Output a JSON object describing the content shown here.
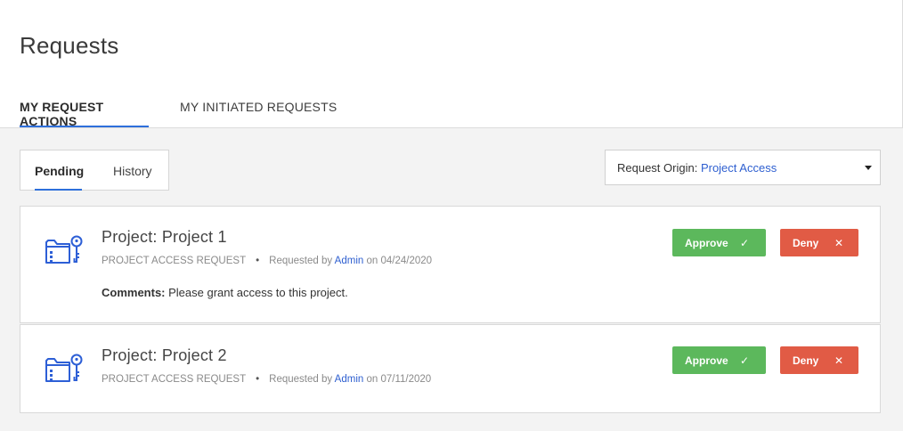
{
  "page": {
    "title": "Requests"
  },
  "main_tabs": [
    {
      "label": "MY REQUEST ACTIONS",
      "active": true
    },
    {
      "label": "MY INITIATED REQUESTS",
      "active": false
    }
  ],
  "sub_tabs": [
    {
      "label": "Pending",
      "active": true
    },
    {
      "label": "History",
      "active": false
    }
  ],
  "filter": {
    "label": "Request Origin: ",
    "value": "Project Access"
  },
  "requests": [
    {
      "title": "Project: Project 1",
      "type": "PROJECT ACCESS REQUEST",
      "requested_by_prefix": "Requested by ",
      "requester": "Admin",
      "date_prefix": " on ",
      "date": "04/24/2020",
      "comment_label": "Comments:",
      "comment": " Please grant access to this project.",
      "approve_label": "Approve",
      "deny_label": "Deny"
    },
    {
      "title": "Project: Project 2",
      "type": "PROJECT ACCESS REQUEST",
      "requested_by_prefix": "Requested by ",
      "requester": "Admin",
      "date_prefix": " on ",
      "date": "07/11/2020",
      "approve_label": "Approve",
      "deny_label": "Deny"
    }
  ],
  "icons": {
    "request": "folder-key-icon",
    "approve": "check-icon",
    "deny": "close-icon",
    "dropdown": "caret-down-icon"
  },
  "colors": {
    "accent": "#2e6fdb",
    "approve": "#5cb85c",
    "deny": "#e15b45",
    "link": "#2e5fd0",
    "icon": "#2d5fd6"
  }
}
